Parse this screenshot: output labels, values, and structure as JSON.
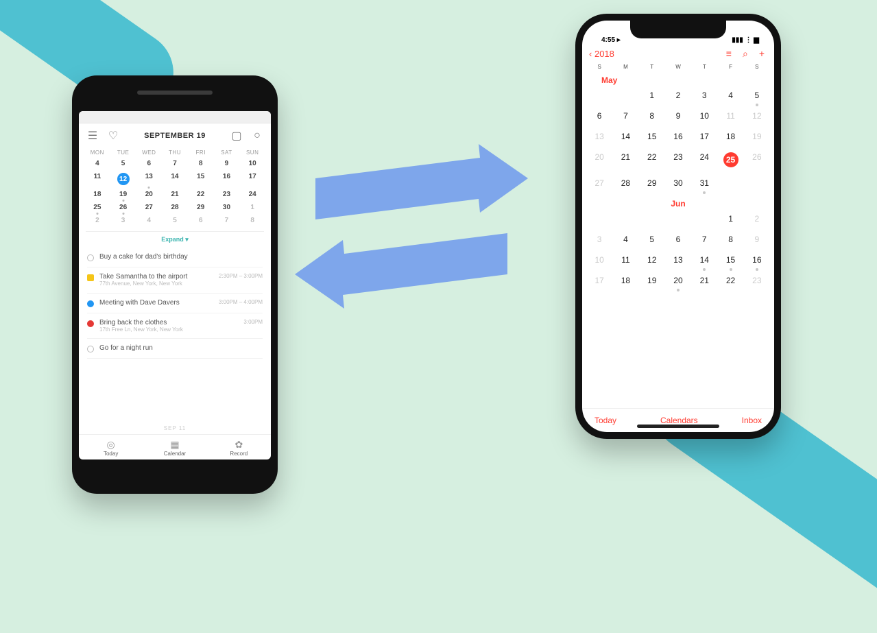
{
  "android": {
    "header": {
      "title": "SEPTEMBER 19"
    },
    "days": [
      "MON",
      "TUE",
      "WED",
      "THU",
      "FRI",
      "SAT",
      "SUN"
    ],
    "weeks": [
      [
        {
          "n": "4"
        },
        {
          "n": "5"
        },
        {
          "n": "6"
        },
        {
          "n": "7"
        },
        {
          "n": "8"
        },
        {
          "n": "9"
        },
        {
          "n": "10"
        }
      ],
      [
        {
          "n": "11"
        },
        {
          "n": "12",
          "sel": true
        },
        {
          "n": "13",
          "dot": true
        },
        {
          "n": "14"
        },
        {
          "n": "15"
        },
        {
          "n": "16"
        },
        {
          "n": "17"
        }
      ],
      [
        {
          "n": "18"
        },
        {
          "n": "19",
          "dot": true
        },
        {
          "n": "20"
        },
        {
          "n": "21"
        },
        {
          "n": "22"
        },
        {
          "n": "23"
        },
        {
          "n": "24"
        }
      ],
      [
        {
          "n": "25",
          "dot": true
        },
        {
          "n": "26",
          "dot": true
        },
        {
          "n": "27"
        },
        {
          "n": "28"
        },
        {
          "n": "29"
        },
        {
          "n": "30"
        },
        {
          "n": "1",
          "dim": true
        }
      ],
      [
        {
          "n": "2",
          "dim": true
        },
        {
          "n": "3",
          "dim": true
        },
        {
          "n": "4",
          "dim": true
        },
        {
          "n": "5",
          "dim": true
        },
        {
          "n": "6",
          "dim": true
        },
        {
          "n": "7",
          "dim": true
        },
        {
          "n": "8",
          "dim": true
        }
      ]
    ],
    "expand": "Expand ▾",
    "events": [
      {
        "bullet": "open",
        "label": "Buy a cake for dad's birthday",
        "time": ""
      },
      {
        "bullet": "yellow",
        "label": "Take Samantha to the airport",
        "sub": "77th Avenue, New York, New York",
        "time": "2:30PM – 3:00PM"
      },
      {
        "bullet": "blue",
        "label": "Meeting with Dave Davers",
        "time": "3:00PM – 4:00PM"
      },
      {
        "bullet": "red",
        "label": "Bring back the clothes",
        "sub": "17th Free Ln, New York, New York",
        "time": "3:00PM"
      },
      {
        "bullet": "open",
        "label": "Go for a night run",
        "time": ""
      }
    ],
    "backbar": "SEP 11",
    "nav": {
      "today": "Today",
      "calendar": "Calendar",
      "record": "Record"
    }
  },
  "iphone": {
    "status": {
      "time": "4:55 ▸"
    },
    "back": "2018",
    "days": [
      "S",
      "M",
      "T",
      "W",
      "T",
      "F",
      "S"
    ],
    "monthMay": "May",
    "monthJun": "Jun",
    "mayRows": [
      [
        {
          "n": "-"
        },
        {
          "n": "-"
        },
        {
          "n": "1"
        },
        {
          "n": "2"
        },
        {
          "n": "3"
        },
        {
          "n": "4"
        },
        {
          "n": "5",
          "dot": true
        }
      ],
      [
        {
          "n": "6"
        },
        {
          "n": "7"
        },
        {
          "n": "8"
        },
        {
          "n": "9"
        },
        {
          "n": "10"
        },
        {
          "n": "11",
          "gray": true
        },
        {
          "n": "12",
          "gray": true
        }
      ],
      [
        {
          "n": "13",
          "gray": true
        },
        {
          "n": "14"
        },
        {
          "n": "15"
        },
        {
          "n": "16"
        },
        {
          "n": "17"
        },
        {
          "n": "18"
        },
        {
          "n": "19",
          "gray": true
        }
      ],
      [
        {
          "n": "20",
          "gray": true
        },
        {
          "n": "21"
        },
        {
          "n": "22"
        },
        {
          "n": "23"
        },
        {
          "n": "24"
        },
        {
          "n": "25",
          "sel": true
        },
        {
          "n": "26",
          "gray": true
        }
      ],
      [
        {
          "n": "27",
          "gray": true
        },
        {
          "n": "28"
        },
        {
          "n": "29"
        },
        {
          "n": "30"
        },
        {
          "n": "31",
          "dot": true
        },
        {
          "n": "-"
        },
        {
          "n": "-"
        }
      ]
    ],
    "junRows": [
      [
        {
          "n": "-"
        },
        {
          "n": "-"
        },
        {
          "n": "-"
        },
        {
          "n": "-"
        },
        {
          "n": "-"
        },
        {
          "n": "1"
        },
        {
          "n": "2",
          "gray": true
        }
      ],
      [
        {
          "n": "3",
          "gray": true
        },
        {
          "n": "4"
        },
        {
          "n": "5"
        },
        {
          "n": "6"
        },
        {
          "n": "7"
        },
        {
          "n": "8"
        },
        {
          "n": "9",
          "gray": true
        }
      ],
      [
        {
          "n": "10",
          "gray": true
        },
        {
          "n": "11"
        },
        {
          "n": "12"
        },
        {
          "n": "13"
        },
        {
          "n": "14",
          "dot": true
        },
        {
          "n": "15",
          "dot": true
        },
        {
          "n": "16",
          "dot": true
        }
      ],
      [
        {
          "n": "17",
          "gray": true
        },
        {
          "n": "18"
        },
        {
          "n": "19"
        },
        {
          "n": "20",
          "dot": true
        },
        {
          "n": "21"
        },
        {
          "n": "22"
        },
        {
          "n": "23",
          "gray": true
        }
      ]
    ],
    "toolbar": {
      "today": "Today",
      "calendars": "Calendars",
      "inbox": "Inbox"
    }
  }
}
